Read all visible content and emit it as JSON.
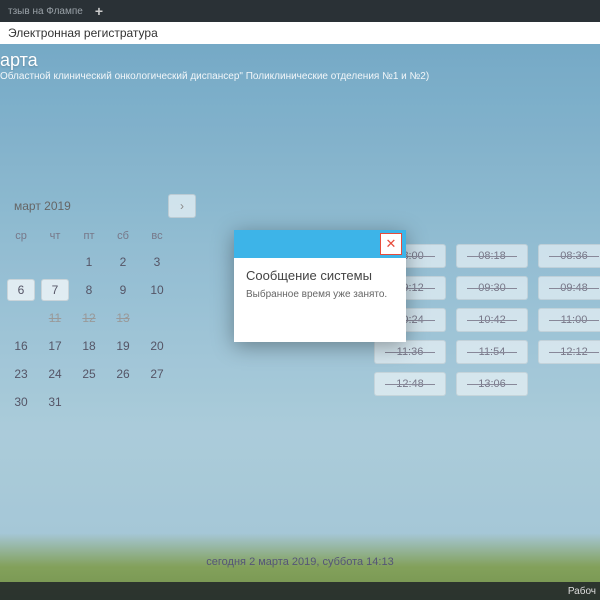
{
  "browser": {
    "tab_label": "тзыв на Флампе",
    "url": "Электронная регистратура"
  },
  "header": {
    "title": "арта",
    "subtitle": "Областной клинический онкологический диспансер\" Поликлинические отделения №1 и №2)"
  },
  "calendar": {
    "month": "март 2019",
    "weekdays": [
      "ср",
      "чт",
      "пт",
      "сб",
      "вс"
    ],
    "rows": [
      [
        "",
        "",
        "1",
        "2",
        "3"
      ],
      [
        "6",
        "7",
        "8",
        "9",
        "10"
      ],
      [
        "",
        "11",
        "12",
        "13",
        ""
      ],
      [
        "16",
        "17",
        "18",
        "19",
        "20"
      ],
      [
        "23",
        "24",
        "25",
        "26",
        "27"
      ],
      [
        "30",
        "31",
        "",
        "",
        ""
      ]
    ]
  },
  "slots": [
    "08:00",
    "08:18",
    "08:36",
    "09:12",
    "09:30",
    "09:48",
    "10:24",
    "10:42",
    "11:00",
    "11:36",
    "11:54",
    "12:12",
    "12:48",
    "13:06"
  ],
  "modal": {
    "title": "Сообщение системы",
    "text": "Выбранное время уже занято."
  },
  "footer": {
    "today": "сегодня 2 марта 2019, суббота 14:13"
  },
  "taskbar": {
    "right": "Рабоч"
  }
}
